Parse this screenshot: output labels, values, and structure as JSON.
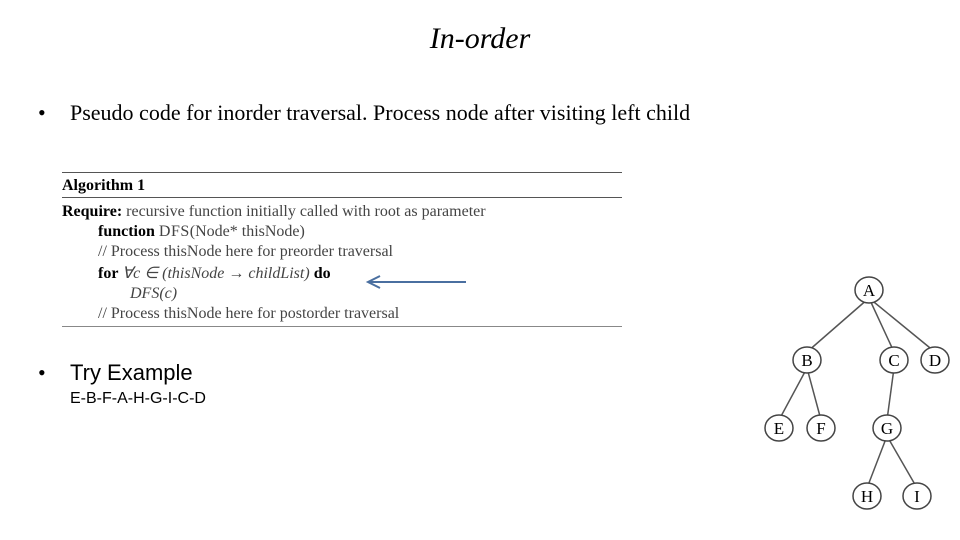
{
  "title": "In-order",
  "bullet1": "Pseudo code for inorder traversal. Process node after visiting left child",
  "algo": {
    "heading": "Algorithm 1",
    "require_kw": "Require:",
    "require_txt": " recursive function initially called with root as parameter",
    "fn_kw": "function ",
    "fn_name": "DFS",
    "fn_sig": "(Node* thisNode)",
    "pre_comment": "// Process thisNode here for preorder traversal",
    "for_kw": "for   ",
    "for_cond": "∀c ∈ (thisNode → childList)",
    "do_kw": "  do",
    "rec_call": "DFS(c)",
    "post_comment": "// Process thisNode here for postorder traversal"
  },
  "try_label": "Try Example",
  "try_answer": "E-B-F-A-H-G-I-C-D",
  "tree": {
    "nodes": [
      "A",
      "B",
      "C",
      "D",
      "E",
      "F",
      "G",
      "H",
      "I"
    ]
  }
}
